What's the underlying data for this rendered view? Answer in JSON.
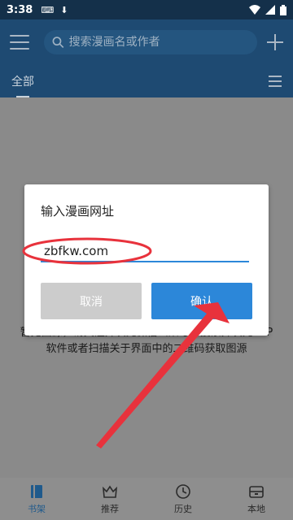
{
  "status_bar": {
    "time": "3:38"
  },
  "toolbar": {
    "search_placeholder": "搜索漫画名或作者"
  },
  "tabs": [
    {
      "label": "全部"
    }
  ],
  "empty_message": {
    "line1": "暂无图源，请关注异次元微信公众号：搜索异次元APP",
    "line2": "软件或者扫描关于界面中的二维码获取图源"
  },
  "dialog": {
    "title": "输入漫画网址",
    "input_value": "zbfkw.com",
    "cancel_label": "取消",
    "confirm_label": "确认"
  },
  "bottom_nav": [
    {
      "label": "书架",
      "icon": "book-icon",
      "active": true
    },
    {
      "label": "推荐",
      "icon": "crown-icon",
      "active": false
    },
    {
      "label": "历史",
      "icon": "clock-icon",
      "active": false
    },
    {
      "label": "本地",
      "icon": "storage-icon",
      "active": false
    }
  ],
  "colors": {
    "toolbar": "#1e4a72",
    "accent": "#2c87d9",
    "annotation": "#e8323c"
  }
}
